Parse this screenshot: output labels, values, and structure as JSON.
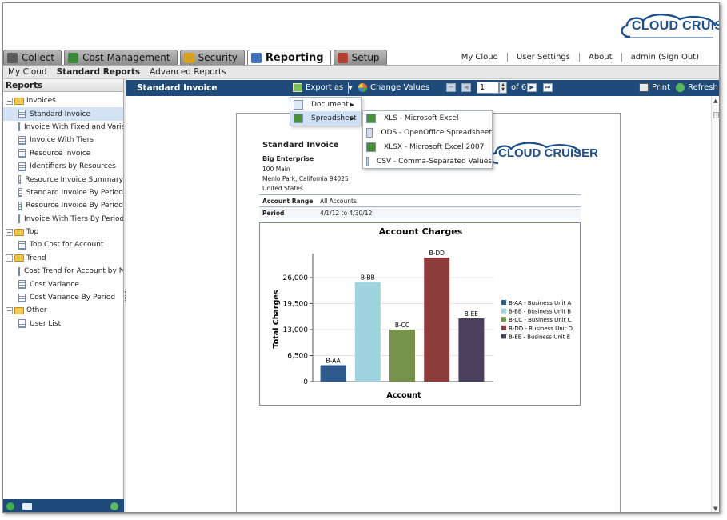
{
  "logo": {
    "text": "CLOUD CRUISER"
  },
  "tabs": [
    {
      "label": "Collect",
      "icon": "funnel-icon",
      "color": "#5a5a5a"
    },
    {
      "label": "Cost Management",
      "icon": "money-icon",
      "color": "#3a8a3a"
    },
    {
      "label": "Security",
      "icon": "lock-icon",
      "color": "#d6a020"
    },
    {
      "label": "Reporting",
      "icon": "report-icon",
      "color": "#3f6fb5",
      "active": true
    },
    {
      "label": "Setup",
      "icon": "tools-icon",
      "color": "#b04030"
    }
  ],
  "toplinks": [
    "My Cloud",
    "User Settings",
    "About",
    "admin (Sign Out)"
  ],
  "subnav": [
    "My Cloud",
    "Standard Reports",
    "Advanced Reports"
  ],
  "left_panel": {
    "title": "Reports",
    "tree": [
      {
        "type": "folder",
        "label": "Invoices"
      },
      {
        "type": "leaf",
        "label": "Standard Invoice",
        "selected": true
      },
      {
        "type": "leaf",
        "label": "Invoice With Fixed and Variable"
      },
      {
        "type": "leaf",
        "label": "Invoice With Tiers"
      },
      {
        "type": "leaf",
        "label": "Resource Invoice"
      },
      {
        "type": "leaf",
        "label": "Identifiers by Resources"
      },
      {
        "type": "leaf",
        "label": "Resource Invoice Summary"
      },
      {
        "type": "leaf",
        "label": "Standard Invoice By Period"
      },
      {
        "type": "leaf",
        "label": "Resource Invoice By Period"
      },
      {
        "type": "leaf",
        "label": "Invoice With Tiers By Period"
      },
      {
        "type": "folder",
        "label": "Top"
      },
      {
        "type": "leaf",
        "label": "Top Cost for Account"
      },
      {
        "type": "folder",
        "label": "Trend"
      },
      {
        "type": "leaf",
        "label": "Cost Trend for Account by Mont"
      },
      {
        "type": "leaf",
        "label": "Cost Variance"
      },
      {
        "type": "leaf",
        "label": "Cost Variance By Period"
      },
      {
        "type": "folder",
        "label": "Other"
      },
      {
        "type": "leaf",
        "label": "User List"
      }
    ]
  },
  "toolbar": {
    "title": "Standard Invoice",
    "export_label": "Export as",
    "change_values_label": "Change Values",
    "page_value": "1",
    "page_of": "of 6",
    "print_label": "Print",
    "refresh_label": "Refresh"
  },
  "export_menu": {
    "items": [
      {
        "label": "Document",
        "icon": "document-icon"
      },
      {
        "label": "Spreadsheet",
        "icon": "spreadsheet-icon"
      }
    ],
    "spreadsheet_items": [
      {
        "label": "XLS - Microsoft Excel",
        "icon": "excel-icon"
      },
      {
        "label": "ODS - OpenOffice Spreadsheet",
        "icon": "ods-icon"
      },
      {
        "label": "XLSX - Microsoft Excel 2007",
        "icon": "excel-icon"
      },
      {
        "label": "CSV - Comma-Separated Values",
        "icon": "csv-icon"
      }
    ]
  },
  "report": {
    "title": "Standard Invoice",
    "company": "Big Enterprise",
    "address": [
      "100 Main",
      "Menlo Park, California  94025",
      "United States"
    ],
    "logo_text": "CLOUD CRUISER",
    "rows": [
      {
        "key": "Account Range",
        "value": "All Accounts"
      },
      {
        "key": "Period",
        "value": "4/1/12 to 4/30/12"
      }
    ]
  },
  "chart_data": {
    "type": "bar",
    "title": "Account Charges",
    "xlabel": "Account",
    "ylabel": "Total Charges",
    "categories": [
      "B-AA",
      "B-BB",
      "B-CC",
      "B-DD",
      "B-EE"
    ],
    "values": [
      4100,
      24900,
      13000,
      31000,
      15800
    ],
    "colors": [
      "#2d5a8c",
      "#9fd3e0",
      "#76924a",
      "#8e3b3b",
      "#4a3f5c"
    ],
    "legend": [
      "B-AA - Business Unit A",
      "B-BB - Business Unit B",
      "B-CC - Business Unit C",
      "B-DD - Business Unit D",
      "B-EE - Business Unit E"
    ],
    "legend_position": "right",
    "yticks": [
      0,
      6500,
      13000,
      19500,
      26000
    ],
    "ytick_labels": [
      "0",
      "6,500",
      "13,000",
      "19,500",
      "26,000"
    ],
    "ylim": [
      0,
      32000
    ],
    "grid": true
  }
}
